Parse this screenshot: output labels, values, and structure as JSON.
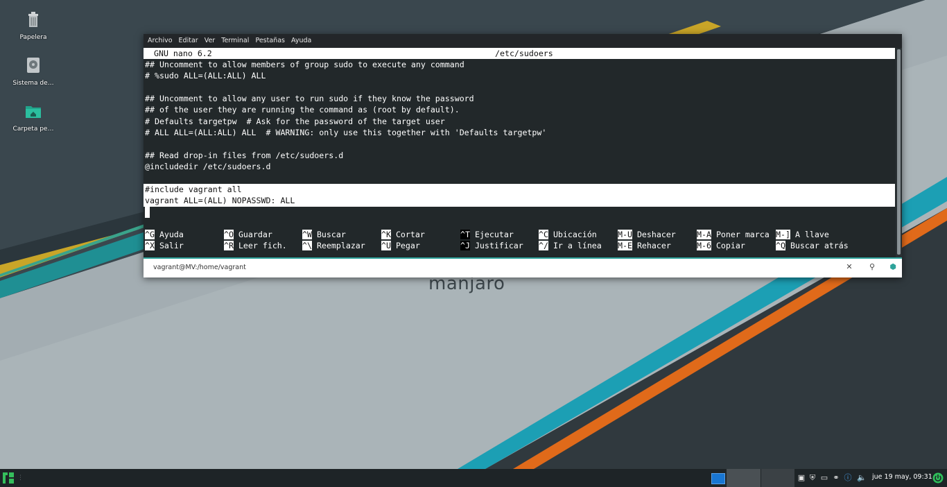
{
  "desktop": {
    "icons": [
      {
        "label": "Papelera",
        "icon": "trash-icon"
      },
      {
        "label": "Sistema de…",
        "icon": "drive-icon"
      },
      {
        "label": "Carpeta pe…",
        "icon": "home-folder-icon"
      }
    ],
    "brand": "manjaro"
  },
  "terminal": {
    "menu": [
      "Archivo",
      "Editar",
      "Ver",
      "Terminal",
      "Pestañas",
      "Ayuda"
    ],
    "nano_title": {
      "name": "GNU nano 6.2",
      "file": "/etc/sudoers"
    },
    "lines": [
      "## Uncomment to allow members of group sudo to execute any command",
      "# %sudo ALL=(ALL:ALL) ALL",
      "",
      "## Uncomment to allow any user to run sudo if they know the password",
      "## of the user they are running the command as (root by default).",
      "# Defaults targetpw  # Ask for the password of the target user",
      "# ALL ALL=(ALL:ALL) ALL  # WARNING: only use this together with 'Defaults targetpw'",
      "",
      "## Read drop-in files from /etc/sudoers.d",
      "@includedir /etc/sudoers.d",
      "",
      "#include vagrant all",
      "vagrant ALL=(ALL) NOPASSWD: ALL"
    ],
    "shortcuts": [
      [
        {
          "key": "^G",
          "label": "Ayuda"
        },
        {
          "key": "^O",
          "label": "Guardar"
        },
        {
          "key": "^W",
          "label": "Buscar"
        },
        {
          "key": "^K",
          "label": "Cortar"
        },
        {
          "key": "^T",
          "label": "Ejecutar"
        },
        {
          "key": "^C",
          "label": "Ubicación"
        },
        {
          "key": "M-U",
          "label": "Deshacer"
        },
        {
          "key": "M-A",
          "label": "Poner marca"
        },
        {
          "key": "M-]",
          "label": "A llave"
        }
      ],
      [
        {
          "key": "^X",
          "label": "Salir"
        },
        {
          "key": "^R",
          "label": "Leer fich."
        },
        {
          "key": "^\\",
          "label": "Reemplazar"
        },
        {
          "key": "^U",
          "label": "Pegar"
        },
        {
          "key": "^J",
          "label": "Justificar"
        },
        {
          "key": "^/",
          "label": "Ir a línea"
        },
        {
          "key": "M-E",
          "label": "Rehacer"
        },
        {
          "key": "M-6",
          "label": "Copiar"
        },
        {
          "key": "^Q",
          "label": "Buscar atrás"
        }
      ]
    ],
    "status_path": "vagrant@MV:/home/vagrant"
  },
  "panel": {
    "clock": "jue 19 may, 09:31"
  },
  "colors": {
    "accent": "#2ea39b",
    "panel_bg": "#1e2427",
    "terminal_bg": "#22282a"
  }
}
